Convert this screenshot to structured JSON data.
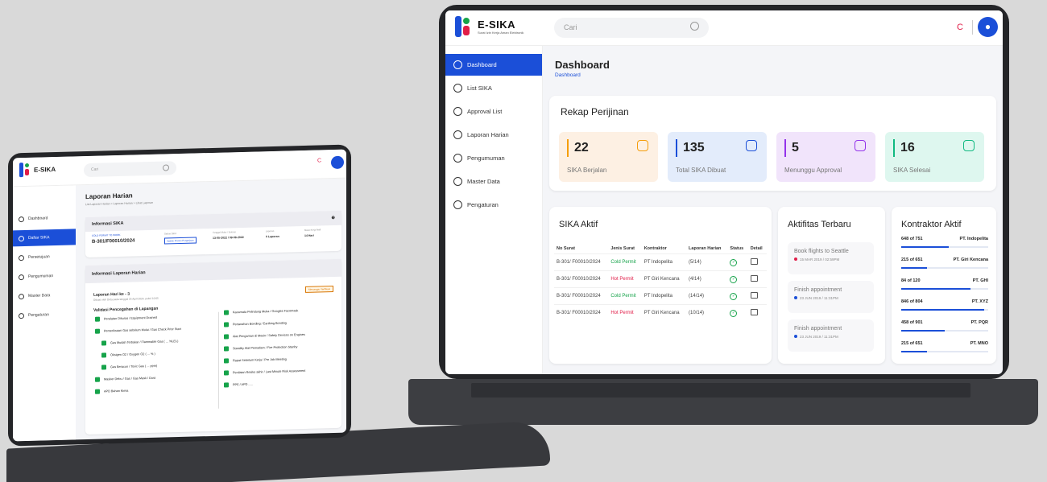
{
  "big": {
    "logo": {
      "title": "E-SIKA",
      "subtitle": "Surat Izin Kerja Aman Elektronik"
    },
    "search_placeholder": "Cari",
    "sidebar": [
      {
        "label": "Dashboard",
        "active": true
      },
      {
        "label": "List SIKA"
      },
      {
        "label": "Approval List"
      },
      {
        "label": "Laporan Harian"
      },
      {
        "label": "Pengumuman"
      },
      {
        "label": "Master Data"
      },
      {
        "label": "Pengaturan"
      }
    ],
    "page_title": "Dashboard",
    "breadcrumb": "Dashboard",
    "rekap": {
      "title": "Rekap Perijinan",
      "stats": [
        {
          "value": "22",
          "label": "SIKA Berjalan",
          "color": "#f59e0b",
          "bg": "#fdf0e3"
        },
        {
          "value": "135",
          "label": "Total SIKA Dibuat",
          "color": "#1b4fd8",
          "bg": "#e3ecfb"
        },
        {
          "value": "5",
          "label": "Menunggu Approval",
          "color": "#9333ea",
          "bg": "#f1e4fb"
        },
        {
          "value": "16",
          "label": "SIKA Selesai",
          "color": "#10b981",
          "bg": "#def7ef"
        }
      ]
    },
    "sika_aktif": {
      "title": "SIKA Aktif",
      "columns": [
        "No Surat",
        "Jenis Surat",
        "Kontraktor",
        "Laporan Harian",
        "Status",
        "Detail"
      ],
      "rows": [
        {
          "no": "B-301/ F00010/2024",
          "jenis": "Cold Permit",
          "kontraktor": "PT Indopelita",
          "laporan": "(5/14)"
        },
        {
          "no": "B-301/ F00010/2024",
          "jenis": "Hot Permit",
          "kontraktor": "PT Giri Kencana",
          "laporan": "(4/14)"
        },
        {
          "no": "B-301/ F00010/2024",
          "jenis": "Cold Permit",
          "kontraktor": "PT Indopelita",
          "laporan": "(14/14)"
        },
        {
          "no": "B-301/ F00010/2024",
          "jenis": "Hot Permit",
          "kontraktor": "PT Giri Kencana",
          "laporan": "(10/14)"
        }
      ]
    },
    "aktifitas": {
      "title": "Aktifitas Terbaru",
      "items": [
        {
          "text": "Book flights to Seattle",
          "date": "15 MAR 2019 / 02:59PM",
          "dot": "#e11d48"
        },
        {
          "text": "Finish appointment",
          "date": "23 JUN 2019 / 11:31PM",
          "dot": "#1b4fd8"
        },
        {
          "text": "Finish appointment",
          "date": "23 JUN 2019 / 11:31PM",
          "dot": "#1b4fd8"
        }
      ]
    },
    "kontraktor": {
      "title": "Kontraktor Aktif",
      "items": [
        {
          "count": "648 of 751",
          "name": "PT. Indopelita",
          "fill": 0.55
        },
        {
          "count": "215 of 651",
          "name": "PT. Giri Kencana",
          "fill": 0.3
        },
        {
          "count": "84 of 120",
          "name": "PT. GHI",
          "fill": 0.8
        },
        {
          "count": "846 of 804",
          "name": "PT. XYZ",
          "fill": 0.95
        },
        {
          "count": "458 of 901",
          "name": "PT. PQR",
          "fill": 0.5
        },
        {
          "count": "215 of 651",
          "name": "PT. MNO",
          "fill": 0.3
        }
      ]
    }
  },
  "small": {
    "logo_title": "E-SIKA",
    "search_placeholder": "Cari",
    "sidebar": [
      {
        "label": "Dashboard"
      },
      {
        "label": "Daftar SIKA",
        "active": true
      },
      {
        "label": "Persetujuan"
      },
      {
        "label": "Pengumuman"
      },
      {
        "label": "Master Data"
      },
      {
        "label": "Pengaturan"
      }
    ],
    "page_title": "Laporan Harian",
    "breadcrumb": "List Laporan Harian  >  Laporan Harian  >  Lihat Laporan",
    "info_title": "Informasi SIKA",
    "permit_type": "COLD PERMIT TO WORK",
    "permit_no": "B-301/F00010/2024",
    "info_cols": [
      "Status SIKA",
      "Tanggal Mulai / Selesai",
      "Laporan",
      "Masa Kerja Aktif"
    ],
    "info_vals": [
      "Update Proses Pengerjaan",
      "13-05-2022 / 09-06-2022",
      "0 Laporan",
      "14 Hari"
    ],
    "laporan_title": "Informasi Laporan Harian",
    "laporan_hari": "Laporan Hari ke - 3",
    "laporan_sub": "Dibuat oleh Deta pada tanggal 25 April 2024, pukul 10:05",
    "badge": "Menunggu Verifikasi",
    "validasi_title": "Validasi Pencegahan di Lapangan",
    "left_items": [
      "Peralatan Dikuras / Equipment Drained",
      "Pemeriksaan Gas sebelum Mulai / Gas Check Prior Start",
      "Gas Mudah Terbakar / Flammable Gas ( ... %LEL)",
      "Oksigen O2 / Oxygen O2 ( ... % )",
      "Gas Beracun / Toxic Gas ( ... ppm)",
      "Masker Debu / Gas / Gas Mask / Dust",
      "APD Bahan Kimia"
    ],
    "right_items": [
      "Kacamata Pelindung Muka / Googles Facemask",
      "Pertanahan Bonding / Earthing Bonding",
      "Alat Pengaman di Mesin / Safety Devices on Engines",
      "Standby Alat Pemadam / Fire Protection Stanby",
      "Rapat Sebelum Kerja / Pre Job Meeting",
      "Penilaian Resiko akhir / Last Minute Risk Assessment",
      "PPE / APD ....."
    ]
  }
}
